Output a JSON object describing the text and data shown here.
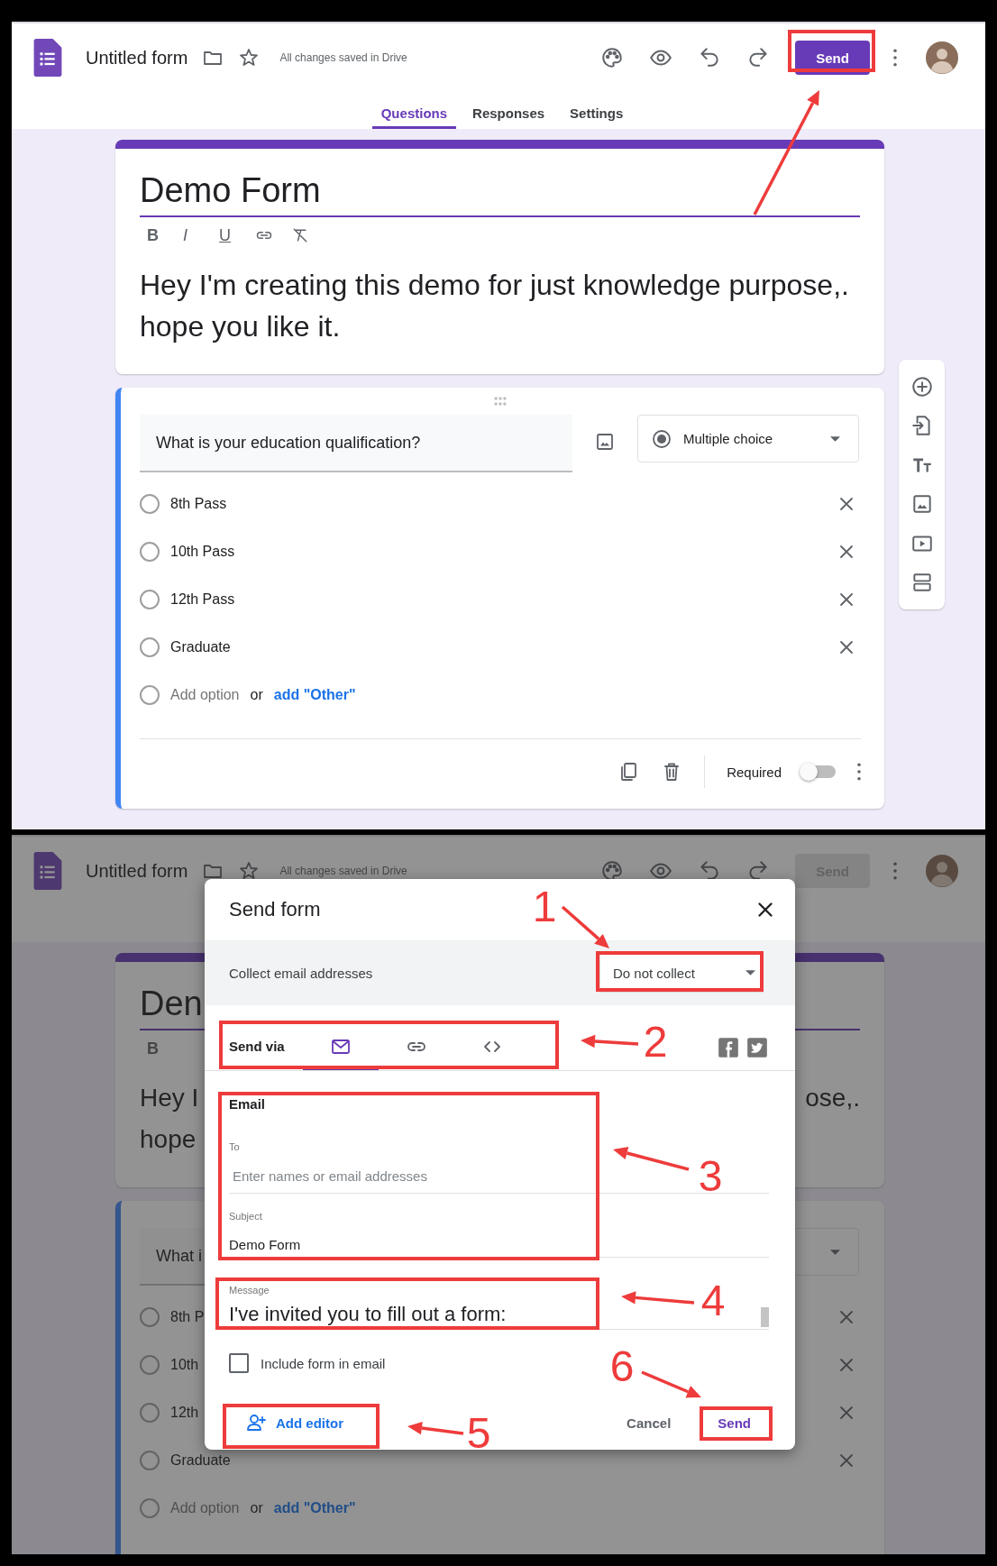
{
  "editor_screen": {
    "header": {
      "app_title": "Untitled form",
      "save_status": "All changes saved in Drive",
      "send_button": {
        "label": "Send",
        "disabled": false
      }
    },
    "tabs": [
      {
        "label": "Questions",
        "selected": true
      },
      {
        "label": "Responses",
        "selected": false
      },
      {
        "label": "Settings",
        "selected": false
      }
    ],
    "form_title": "Demo Form",
    "format_letters": [
      "B",
      "I",
      "U"
    ],
    "format_tools": [
      {
        "kind": "link"
      },
      {
        "kind": "clear-format"
      }
    ],
    "description": "Hey I'm creating this demo for just knowledge purpose,. hope you like it.",
    "question": {
      "text": "What is your education qualification?",
      "type": "Multiple choice",
      "options": [
        "8th Pass",
        "10th Pass",
        "12th Pass",
        "Graduate"
      ],
      "add_option": "Add option",
      "or": "or",
      "add_other": "add \"Other\"",
      "required": {
        "label": "Required",
        "on": false
      }
    },
    "side_toolbar": true
  },
  "send_screen": {
    "header": {
      "app_title": "Untitled form",
      "save_status": "All changes saved in Drive",
      "send_button": {
        "label": "Send",
        "disabled": true
      }
    },
    "form_title": "Den",
    "format_letters": [
      "B"
    ],
    "description_fragments": [
      {
        "left": "Hey I",
        "right": "ose,."
      },
      {
        "left": "hope"
      }
    ],
    "question": {
      "text": "What i",
      "options": [
        "8th P",
        "10th",
        "12th",
        "Graduate"
      ],
      "add_option": "Add option",
      "or": "or",
      "add_other": "add \"Other\""
    },
    "side_toolbar": false,
    "dialog": {
      "title": "Send form",
      "collect_label": "Collect email addresses",
      "collect_value": "Do not collect",
      "send_via_label": "Send via",
      "send_via_tabs": [
        {
          "kind": "email",
          "selected": true
        },
        {
          "kind": "link",
          "selected": false
        },
        {
          "kind": "embed",
          "selected": false
        }
      ],
      "email_heading": "Email",
      "to_label": "To",
      "to_placeholder": "Enter names or email addresses",
      "subject_label": "Subject",
      "subject_value": "Demo Form",
      "message_label": "Message",
      "message_value": "I've invited you to fill out a form:",
      "include_form": {
        "label": "Include form in email",
        "checked": false
      },
      "add_editor": "Add editor",
      "cancel": "Cancel",
      "send": "Send"
    }
  },
  "annotations": [
    {
      "kind": "send-button"
    },
    {
      "kind": "collect",
      "number": "1"
    },
    {
      "kind": "send-via",
      "number": "2"
    },
    {
      "kind": "email",
      "number": "3"
    },
    {
      "kind": "message",
      "number": "4"
    },
    {
      "kind": "add-editor",
      "number": "5"
    },
    {
      "kind": "send",
      "number": "6"
    }
  ]
}
